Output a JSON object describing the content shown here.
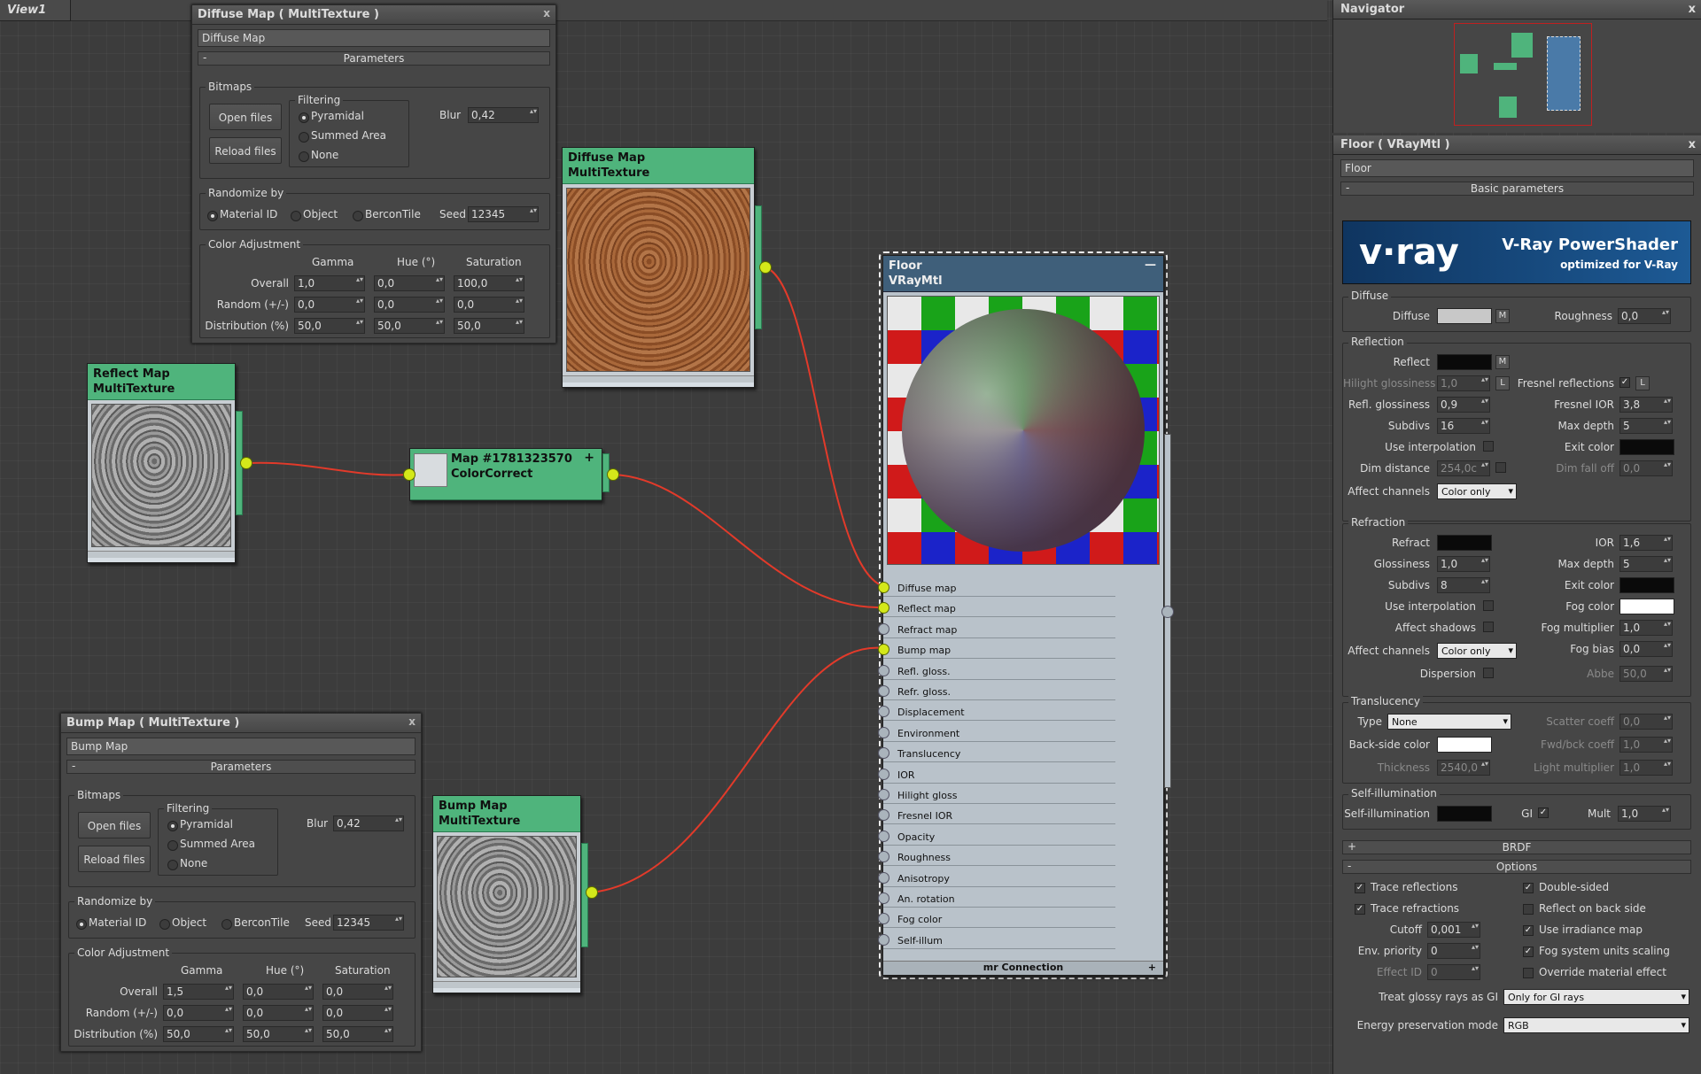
{
  "viewport": {
    "tab": "View1"
  },
  "diffuse_window": {
    "title": "Diffuse Map  ( MultiTexture )",
    "name": "Diffuse Map",
    "rollout": "Parameters",
    "bitmaps_label": "Bitmaps",
    "open_files": "Open files",
    "reload_files": "Reload files",
    "filtering_label": "Filtering",
    "filter_options": [
      "Pyramidal",
      "Summed Area",
      "None"
    ],
    "blur_label": "Blur",
    "blur": "0,42",
    "randomize_label": "Randomize by",
    "randomize_options": [
      "Material ID",
      "Object",
      "BerconTile"
    ],
    "seed_label": "Seed",
    "seed": "12345",
    "color_adj_label": "Color Adjustment",
    "cols": [
      "Gamma",
      "Hue (°)",
      "Saturation"
    ],
    "rows": [
      {
        "label": "Overall",
        "vals": [
          "1,0",
          "0,0",
          "100,0"
        ]
      },
      {
        "label": "Random (+/-)",
        "vals": [
          "0,0",
          "0,0",
          "0,0"
        ]
      },
      {
        "label": "Distribution (%)",
        "vals": [
          "50,0",
          "50,0",
          "50,0"
        ]
      }
    ]
  },
  "bump_window": {
    "title": "Bump Map  ( MultiTexture )",
    "name": "Bump Map",
    "rollout": "Parameters",
    "bitmaps_label": "Bitmaps",
    "open_files": "Open files",
    "reload_files": "Reload files",
    "filtering_label": "Filtering",
    "filter_options": [
      "Pyramidal",
      "Summed Area",
      "None"
    ],
    "blur_label": "Blur",
    "blur": "0,42",
    "randomize_label": "Randomize by",
    "randomize_options": [
      "Material ID",
      "Object",
      "BerconTile"
    ],
    "seed_label": "Seed",
    "seed": "12345",
    "color_adj_label": "Color Adjustment",
    "cols": [
      "Gamma",
      "Hue (°)",
      "Saturation"
    ],
    "rows": [
      {
        "label": "Overall",
        "vals": [
          "1,5",
          "0,0",
          "0,0"
        ]
      },
      {
        "label": "Random (+/-)",
        "vals": [
          "0,0",
          "0,0",
          "0,0"
        ]
      },
      {
        "label": "Distribution (%)",
        "vals": [
          "50,0",
          "50,0",
          "50,0"
        ]
      }
    ]
  },
  "nodes": {
    "diffuse": {
      "line1": "Diffuse Map",
      "line2": "MultiTexture"
    },
    "reflect": {
      "line1": "Reflect Map",
      "line2": "MultiTexture"
    },
    "colorcorrect": {
      "line1": "Map #1781323570",
      "line2": "ColorCorrect",
      "plus": "+"
    },
    "bump": {
      "line1": "Bump Map",
      "line2": "MultiTexture"
    },
    "floor": {
      "line1": "Floor",
      "line2": "VRayMtl",
      "collapse": "—",
      "footer": "mr Connection",
      "footer_plus": "+",
      "slots": [
        "Diffuse map",
        "Reflect map",
        "Refract map",
        "Bump map",
        "Refl. gloss.",
        "Refr. gloss.",
        "Displacement",
        "Environment",
        "Translucency",
        "IOR",
        "Hilight gloss",
        "Fresnel IOR",
        "Opacity",
        "Roughness",
        "Anisotropy",
        "An. rotation",
        "Fog color",
        "Self-illum"
      ]
    }
  },
  "navigator": {
    "title": "Navigator",
    "close": "x"
  },
  "material_panel": {
    "title": "Floor  ( VRayMtl )",
    "close": "x",
    "name": "Floor",
    "rollout": "Basic parameters",
    "banner_logo": "v·ray",
    "banner_title": "V-Ray PowerShader",
    "banner_sub": "optimized for V-Ray",
    "diffuse": {
      "label": "Diffuse",
      "diffuse": "Diffuse",
      "m": "M",
      "roughness": "Roughness",
      "roughness_val": "0,0"
    },
    "reflection": {
      "label": "Reflection",
      "reflect": "Reflect",
      "m": "M",
      "hilight": "Hilight glossiness",
      "hilight_val": "1,0",
      "l": "L",
      "fresnel": "Fresnel reflections",
      "fresnel_l": "L",
      "refl_gloss": "Refl. glossiness",
      "refl_gloss_val": "0,9",
      "fresnel_ior": "Fresnel IOR",
      "fresnel_ior_val": "3,8",
      "subdivs": "Subdivs",
      "subdivs_val": "16",
      "max_depth": "Max depth",
      "max_depth_val": "5",
      "use_interp": "Use interpolation",
      "exit_color": "Exit color",
      "dim_dist": "Dim distance",
      "dim_dist_val": "254,0c",
      "dim_falloff": "Dim fall off",
      "dim_falloff_val": "0,0",
      "affect": "Affect channels",
      "affect_val": "Color only"
    },
    "refraction": {
      "label": "Refraction",
      "refract": "Refract",
      "ior": "IOR",
      "ior_val": "1,6",
      "gloss": "Glossiness",
      "gloss_val": "1,0",
      "max_depth": "Max depth",
      "max_depth_val": "5",
      "subdivs": "Subdivs",
      "subdivs_val": "8",
      "exit_color": "Exit color",
      "use_interp": "Use interpolation",
      "fog_color": "Fog color",
      "affect_shadows": "Affect shadows",
      "fog_mult": "Fog multiplier",
      "fog_mult_val": "1,0",
      "affect": "Affect channels",
      "affect_val": "Color only",
      "fog_bias": "Fog bias",
      "fog_bias_val": "0,0",
      "dispersion": "Dispersion",
      "abbe": "Abbe",
      "abbe_val": "50,0"
    },
    "translucency": {
      "label": "Translucency",
      "type": "Type",
      "type_val": "None",
      "scatter": "Scatter coeff",
      "scatter_val": "0,0",
      "backside": "Back-side color",
      "fwd": "Fwd/bck coeff",
      "fwd_val": "1,0",
      "thickness": "Thickness",
      "thickness_val": "2540,0",
      "light_mult": "Light multiplier",
      "light_mult_val": "1,0"
    },
    "selfillum": {
      "label": "Self-illumination",
      "self": "Self-illumination",
      "gi": "GI",
      "mult": "Mult",
      "mult_val": "1,0"
    },
    "brdf": {
      "sign": "+",
      "label": "BRDF"
    },
    "options": {
      "sign": "-",
      "label": "Options",
      "trace_refl": "Trace reflections",
      "trace_refr": "Trace refractions",
      "double_sided": "Double-sided",
      "reflect_back": "Reflect on back side",
      "cutoff": "Cutoff",
      "cutoff_val": "0,001",
      "use_irr": "Use irradiance map",
      "env_pri": "Env. priority",
      "env_pri_val": "0",
      "fog_units": "Fog system units scaling",
      "effect_id": "Effect ID",
      "effect_id_val": "0",
      "override": "Override material effect",
      "treat": "Treat glossy rays as GI",
      "treat_val": "Only for GI rays",
      "energy": "Energy preservation mode",
      "energy_val": "RGB"
    }
  },
  "colors": {
    "node_header": "#4fb47c",
    "port_active": "#d4e81a",
    "wire": "#e23a2a",
    "slot_bg": "#b9c2ca"
  }
}
